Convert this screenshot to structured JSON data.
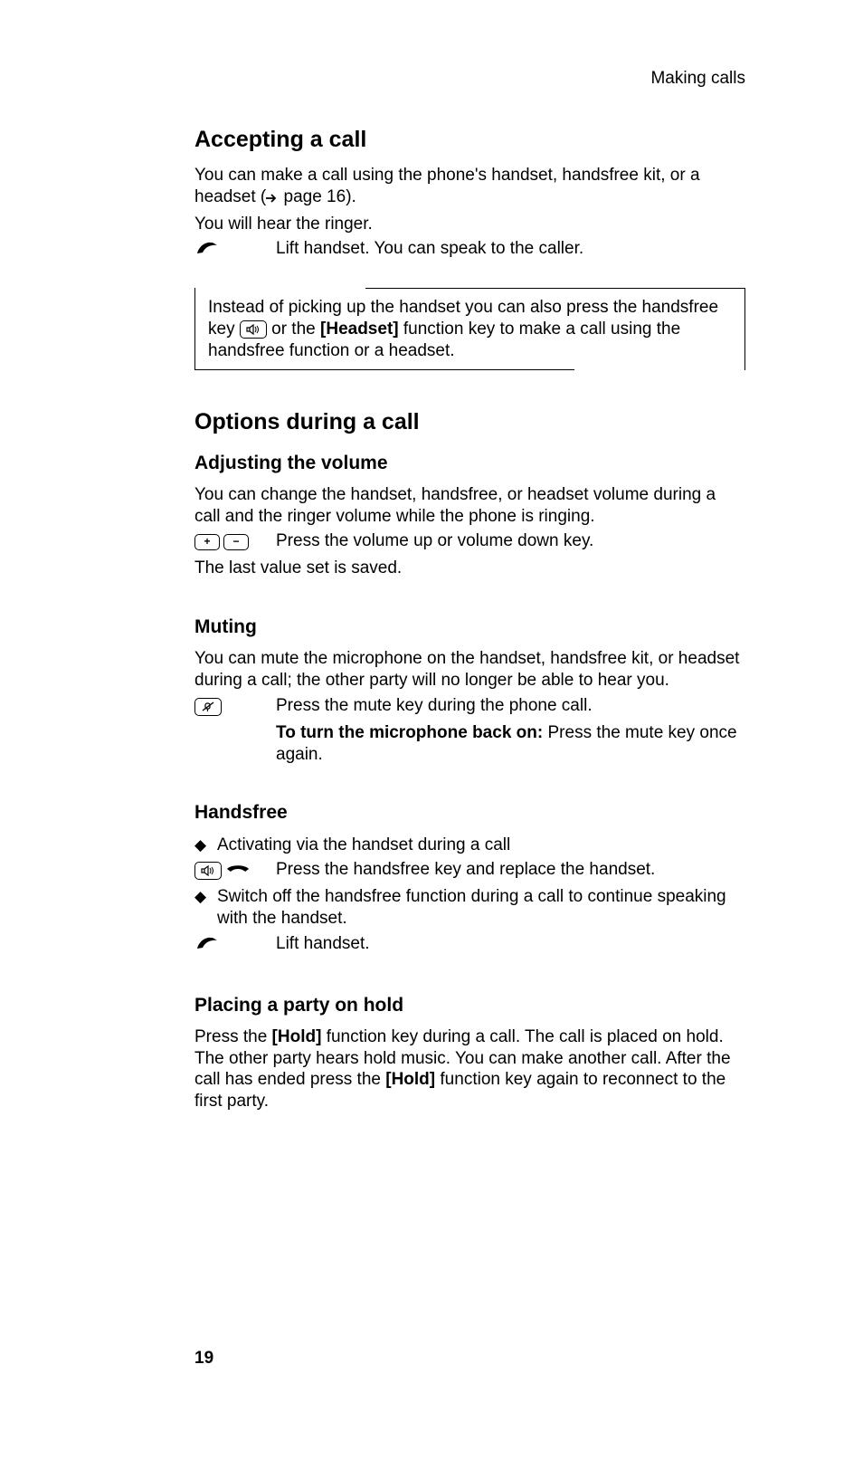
{
  "running_head": "Making calls",
  "section1": {
    "heading": "Accepting a call",
    "p1_a": "You can make a call using the phone's handset, handsfree kit, or a headset (",
    "p1_b": " page 16).",
    "p2": "You will hear the ringer.",
    "step1": "Lift handset. You can speak to the caller.",
    "note_a": "Instead of picking up the handset you can also press the handsfree key ",
    "note_b": " or the ",
    "note_key": "[Headset]",
    "note_c": " function key to make a call using the handsfree function or a headset."
  },
  "section2": {
    "heading": "Options during a call",
    "sub1": {
      "title": "Adjusting the volume",
      "p1": "You can change the handset, handsfree, or headset volume during a call and the ringer volume while the phone is ringing.",
      "step": "Press the volume up or volume down key.",
      "p2": "The last value set is saved."
    },
    "sub2": {
      "title": "Muting",
      "p1": "You can mute the microphone on the handset, handsfree kit, or headset during a call; the other party will no longer be able to hear you.",
      "step": "Press the mute key during the phone call.",
      "bold": "To turn the microphone back on:",
      "rest": " Press the mute key once again."
    },
    "sub3": {
      "title": "Handsfree",
      "b1": "Activating via the handset during a call",
      "step1": "Press the handsfree key and replace the handset.",
      "b2": "Switch off the handsfree function during a call to continue speaking with the handset.",
      "step2": "Lift handset."
    },
    "sub4": {
      "title": "Placing a party on hold",
      "p_a": "Press the ",
      "hold1": "[Hold]",
      "p_b": " function key during a call. The call is placed on hold. The other party hears hold music. You can make another call. After the call has ended press the ",
      "hold2": "[Hold]",
      "p_c": " function key again to reconnect to the first party."
    }
  },
  "page_number": "19"
}
